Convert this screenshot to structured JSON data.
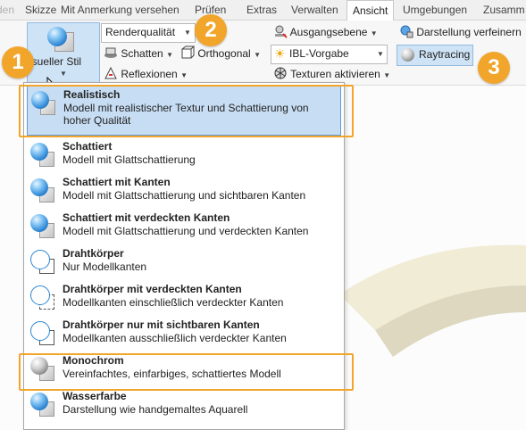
{
  "tabs": [
    "den",
    "Skizze",
    "Mit Anmerkung versehen",
    "Prüfen",
    "Extras",
    "Verwalten",
    "Ansicht",
    "Umgebungen",
    "Zusamm"
  ],
  "active_tab": "Ansicht",
  "ribbon": {
    "visual_style_label": "isueller Stil",
    "render_quality": "Renderqualität",
    "shadows": "Schatten",
    "orthogonal": "Orthogonal",
    "reflections": "Reflexionen",
    "ground_plane": "Ausgangsebene",
    "ibl": "IBL-Vorgabe",
    "textures": "Texturen aktivieren",
    "refine": "Darstellung verfeinern",
    "raytracing": "Raytracing"
  },
  "badges": [
    "1",
    "2",
    "3"
  ],
  "menu": {
    "items": [
      {
        "title": "Realistisch",
        "desc": "Modell mit realistischer Textur und Schattierung von hoher Qualität",
        "icon": "realistic-icon"
      },
      {
        "title": "Schattiert",
        "desc": "Modell mit Glattschattierung",
        "icon": "shaded-icon"
      },
      {
        "title": "Schattiert mit Kanten",
        "desc": "Modell mit Glattschattierung und sichtbaren Kanten",
        "icon": "shaded-edges-icon"
      },
      {
        "title": "Schattiert mit verdeckten Kanten",
        "desc": "Modell mit Glattschattierung und verdeckten Kanten",
        "icon": "shaded-hidden-edges-icon"
      },
      {
        "title": "Drahtkörper",
        "desc": "Nur Modellkanten",
        "icon": "wireframe-icon"
      },
      {
        "title": "Drahtkörper mit verdeckten Kanten",
        "desc": "Modellkanten einschließlich verdeckter Kanten",
        "icon": "wireframe-hidden-icon"
      },
      {
        "title": "Drahtkörper nur mit sichtbaren Kanten",
        "desc": "Modellkanten ausschließlich verdeckter Kanten",
        "icon": "wireframe-visible-icon"
      },
      {
        "title": "Monochrom",
        "desc": "Vereinfachtes, einfarbiges, schattiertes Modell",
        "icon": "monochrome-icon"
      },
      {
        "title": "Wasserfarbe",
        "desc": "Darstellung wie handgemaltes Aquarell",
        "icon": "watercolor-icon"
      }
    ]
  },
  "colors": {
    "accent": "#f2a52b",
    "selection": "#c7ddf3",
    "selection_border": "#5d9bd6"
  }
}
